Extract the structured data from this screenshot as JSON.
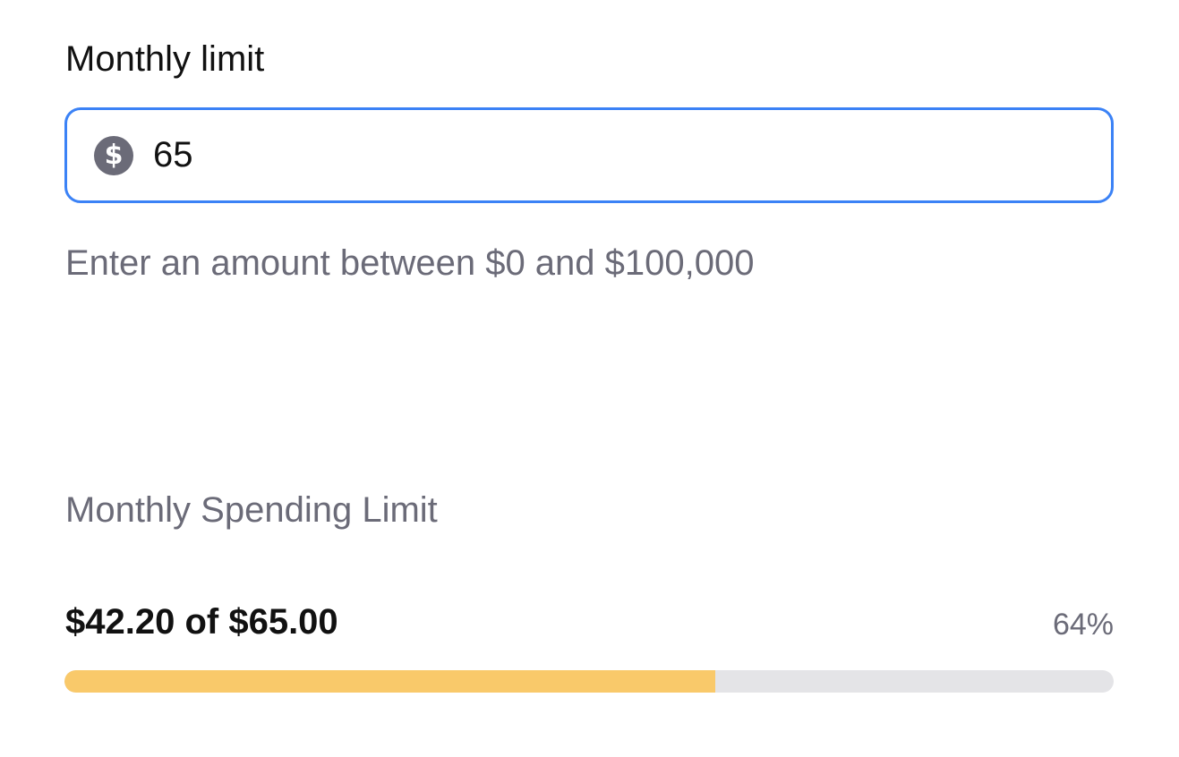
{
  "limit_field": {
    "label": "Monthly limit",
    "currency_icon": "dollar-circle-icon",
    "value": "65",
    "helper": "Enter an amount between $0 and $100,000",
    "focus_color": "#3b82f6"
  },
  "spending": {
    "title": "Monthly Spending Limit",
    "usage": "$42.20 of $65.00",
    "percent_label": "64%",
    "progress": 0.62,
    "fill_color": "#f9c96a",
    "track_color": "#e4e4e7"
  }
}
